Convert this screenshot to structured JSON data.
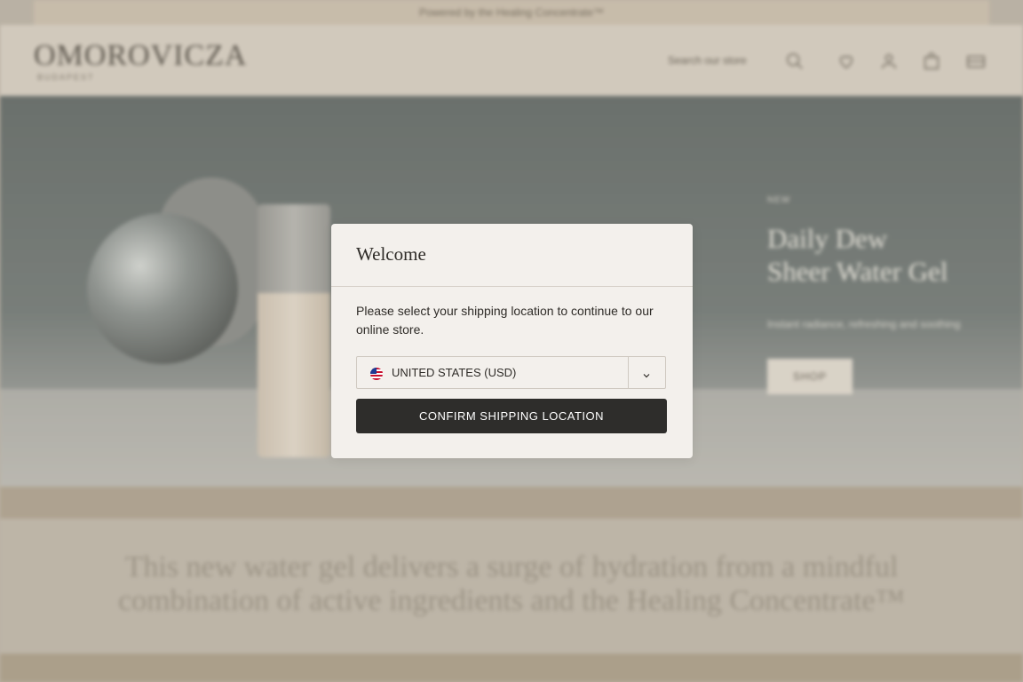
{
  "announcement": {
    "text": "Powered by the Healing Concentrate™"
  },
  "header": {
    "logo": "OMOROVICZA",
    "logo_sub": "BUDAPEST",
    "search_label": "Search our store",
    "icons": [
      "search-icon",
      "heart-icon",
      "user-icon",
      "bag-icon",
      "flag-icon"
    ]
  },
  "hero": {
    "eyebrow": "NEW",
    "title_line1": "Daily Dew",
    "title_line2": "Sheer Water Gel",
    "subtitle": "Instant radiance, refreshing and soothing",
    "cta": "SHOP"
  },
  "copy": {
    "text": "This new water gel delivers a surge of hydration from a mindful combination of active ingredients and the Healing Concentrate™"
  },
  "modal": {
    "title": "Welcome",
    "message": "Please select your shipping location to continue to our online store.",
    "location_value": "UNITED STATES (USD)",
    "confirm_label": "CONFIRM SHIPPING LOCATION"
  },
  "colors": {
    "modal_bg": "#f3f0ec",
    "button_bg": "#2e2d2b",
    "page_bg": "#b8b1a5"
  }
}
